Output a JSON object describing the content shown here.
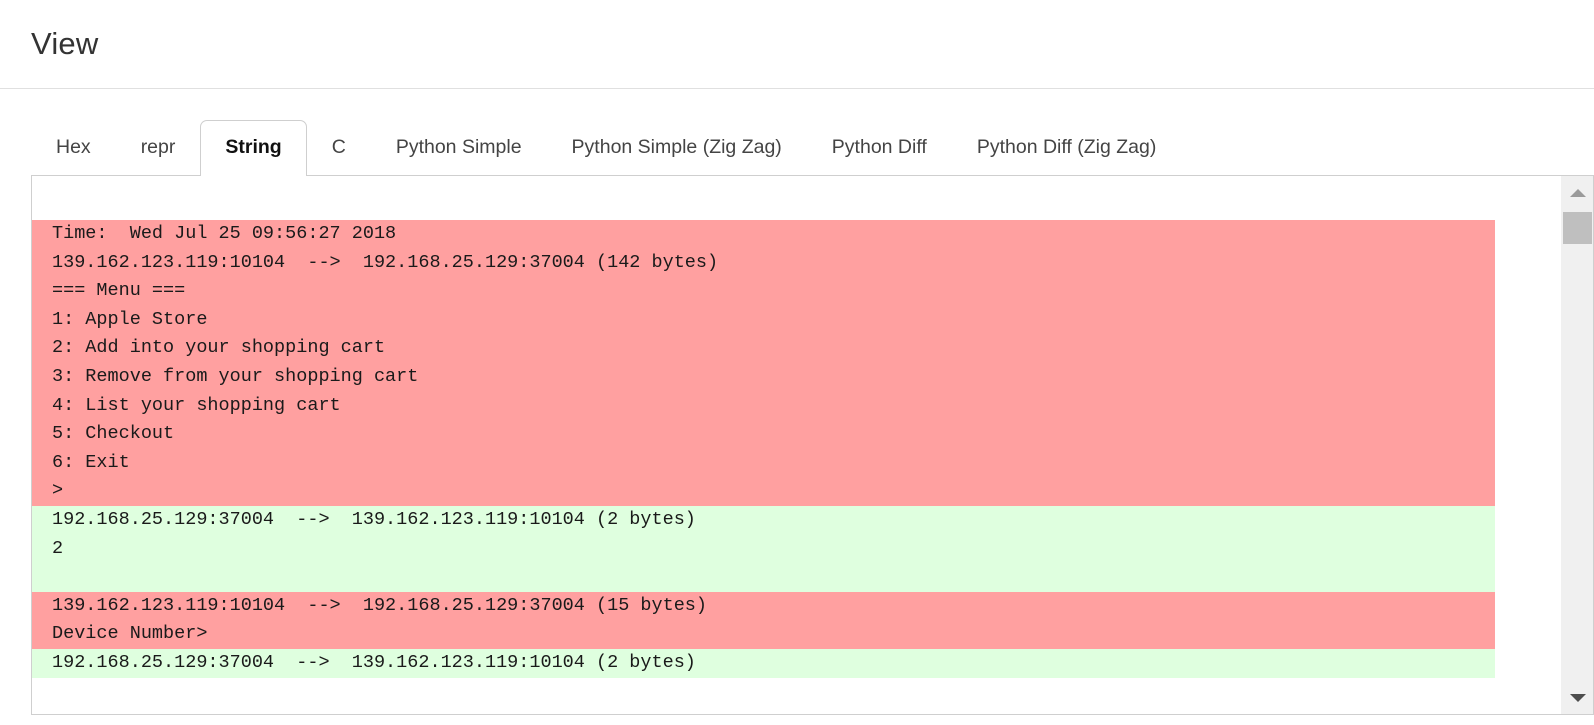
{
  "header": {
    "title": "View"
  },
  "tabs": [
    {
      "label": "Hex",
      "active": false
    },
    {
      "label": "repr",
      "active": false
    },
    {
      "label": "String",
      "active": true
    },
    {
      "label": "C",
      "active": false
    },
    {
      "label": "Python Simple",
      "active": false
    },
    {
      "label": "Python Simple (Zig Zag)",
      "active": false
    },
    {
      "label": "Python Diff",
      "active": false
    },
    {
      "label": "Python Diff (Zig Zag)",
      "active": false
    }
  ],
  "colors": {
    "outbound_bg": "#ffa0a0",
    "inbound_bg": "#dfffdf",
    "panel_border": "#cfcfcf",
    "text": "#1a1a1a"
  },
  "log": {
    "blocks": [
      {
        "direction": "out",
        "lines": [
          "Time:  Wed Jul 25 09:56:27 2018",
          "139.162.123.119:10104  -->  192.168.25.129:37004 (142 bytes)",
          "=== Menu ===",
          "1: Apple Store",
          "2: Add into your shopping cart",
          "3: Remove from your shopping cart",
          "4: List your shopping cart",
          "5: Checkout",
          "6: Exit",
          ">"
        ]
      },
      {
        "direction": "in",
        "lines": [
          "192.168.25.129:37004  -->  139.162.123.119:10104 (2 bytes)",
          "2",
          ""
        ]
      },
      {
        "direction": "out",
        "lines": [
          "139.162.123.119:10104  -->  192.168.25.129:37004 (15 bytes)",
          "Device Number>"
        ]
      },
      {
        "direction": "in",
        "lines": [
          "192.168.25.129:37004  -->  139.162.123.119:10104 (2 bytes)"
        ]
      }
    ]
  },
  "scrollbar": {
    "up_icon": "triangle-up-icon",
    "down_icon": "triangle-down-icon"
  }
}
